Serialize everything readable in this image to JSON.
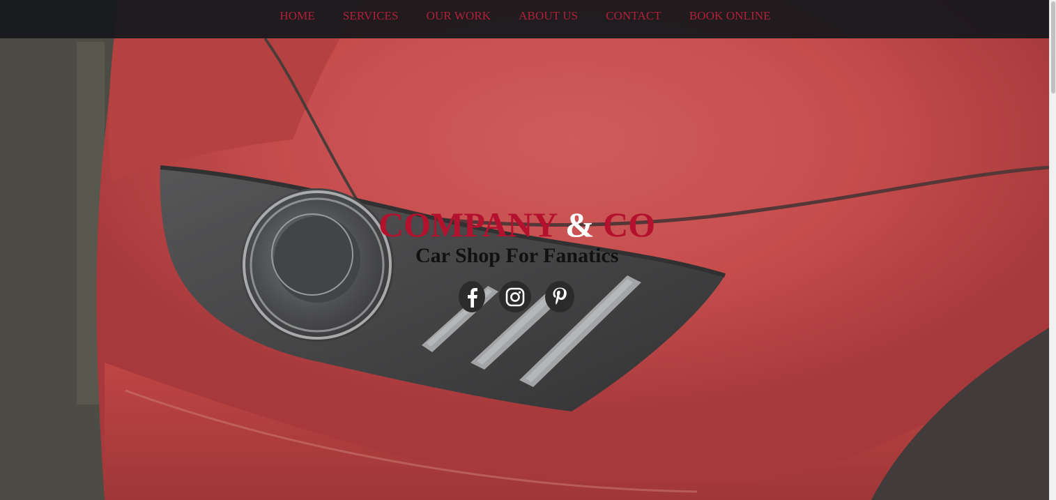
{
  "nav": {
    "items": [
      {
        "label": "HOME"
      },
      {
        "label": "SERVICES"
      },
      {
        "label": "OUR WORK"
      },
      {
        "label": "ABOUT US"
      },
      {
        "label": "CONTACT"
      },
      {
        "label": "BOOK ONLINE"
      }
    ]
  },
  "hero": {
    "brand_part1": "COMPANY",
    "brand_amp": "&",
    "brand_part2": "CO",
    "tagline": "Car Shop For Fanatics",
    "background_image": "red-car-headlight-photo"
  },
  "social": [
    {
      "icon": "facebook-icon"
    },
    {
      "icon": "instagram-icon"
    },
    {
      "icon": "pinterest-icon"
    }
  ],
  "colors": {
    "accent": "#b3112e",
    "nav_text": "#b3203a",
    "nav_bg": "#16181c",
    "tagline": "#111111",
    "icon_bg": "#2b2b2b"
  }
}
